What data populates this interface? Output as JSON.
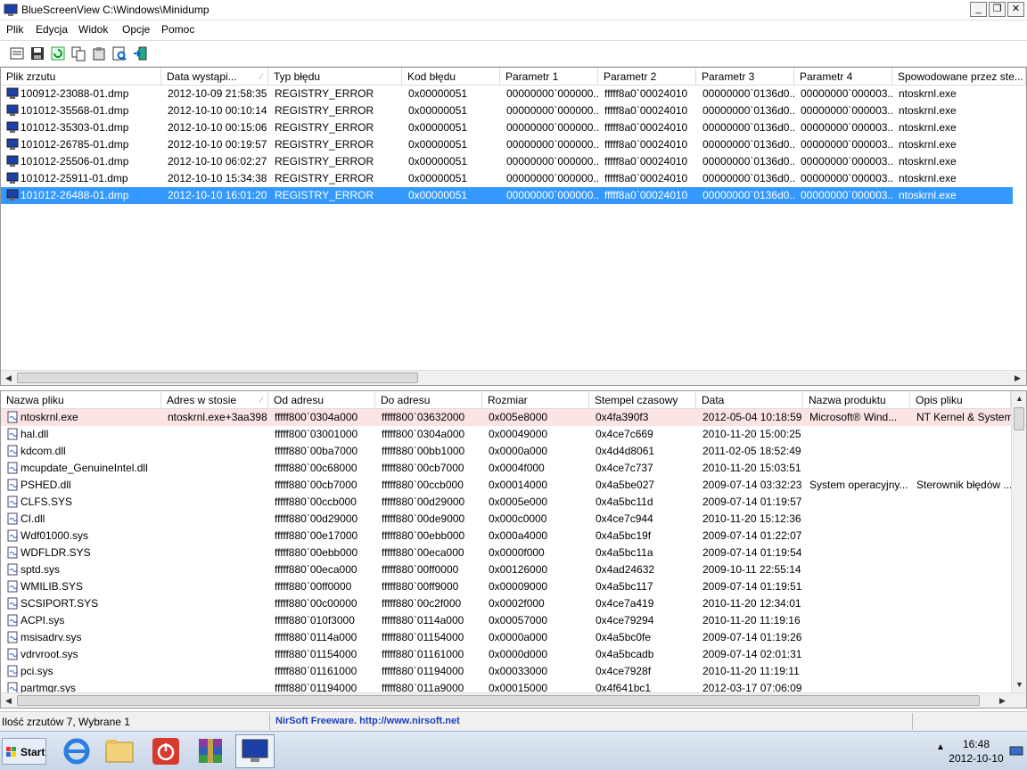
{
  "window": {
    "title": "BlueScreenView   C:\\Windows\\Minidump"
  },
  "menu": [
    "Plik",
    "Edycja",
    "Widok",
    "Opcje",
    "Pomoc"
  ],
  "toolbar": [
    "save-icon",
    "refresh-icon",
    "copy-icon",
    "properties-icon",
    "find-icon",
    "exit-icon"
  ],
  "dumps": {
    "columns": [
      "Plik zrzutu",
      "Data wystąpi...",
      "Typ błędu",
      "Kod błędu",
      "Parametr 1",
      "Parametr 2",
      "Parametr 3",
      "Parametr 4",
      "Spowodowane przez ste..."
    ],
    "sorted_column_indicator": "⁄",
    "rows": [
      [
        "100912-23088-01.dmp",
        "2012-10-09 21:58:35",
        "REGISTRY_ERROR",
        "0x00000051",
        "00000000`000000...",
        "fffff8a0`00024010",
        "00000000`0136d0...",
        "00000000`000003...",
        "ntoskrnl.exe"
      ],
      [
        "101012-35568-01.dmp",
        "2012-10-10 00:10:14",
        "REGISTRY_ERROR",
        "0x00000051",
        "00000000`000000...",
        "fffff8a0`00024010",
        "00000000`0136d0...",
        "00000000`000003...",
        "ntoskrnl.exe"
      ],
      [
        "101012-35303-01.dmp",
        "2012-10-10 00:15:06",
        "REGISTRY_ERROR",
        "0x00000051",
        "00000000`000000...",
        "fffff8a0`00024010",
        "00000000`0136d0...",
        "00000000`000003...",
        "ntoskrnl.exe"
      ],
      [
        "101012-26785-01.dmp",
        "2012-10-10 00:19:57",
        "REGISTRY_ERROR",
        "0x00000051",
        "00000000`000000...",
        "fffff8a0`00024010",
        "00000000`0136d0...",
        "00000000`000003...",
        "ntoskrnl.exe"
      ],
      [
        "101012-25506-01.dmp",
        "2012-10-10 06:02:27",
        "REGISTRY_ERROR",
        "0x00000051",
        "00000000`000000...",
        "fffff8a0`00024010",
        "00000000`0136d0...",
        "00000000`000003...",
        "ntoskrnl.exe"
      ],
      [
        "101012-25911-01.dmp",
        "2012-10-10 15:34:38",
        "REGISTRY_ERROR",
        "0x00000051",
        "00000000`000000...",
        "fffff8a0`00024010",
        "00000000`0136d0...",
        "00000000`000003...",
        "ntoskrnl.exe"
      ],
      [
        "101012-26488-01.dmp",
        "2012-10-10 16:01:20",
        "REGISTRY_ERROR",
        "0x00000051",
        "00000000`000000...",
        "fffff8a0`00024010",
        "00000000`0136d0...",
        "00000000`000003...",
        "ntoskrnl.exe"
      ]
    ],
    "selected_row": 6
  },
  "modules": {
    "columns": [
      "Nazwa pliku",
      "Adres w stosie",
      "Od adresu",
      "Do adresu",
      "Rozmiar",
      "Stempel czasowy",
      "Data",
      "Nazwa produktu",
      "Opis pliku"
    ],
    "highlighted_row": 0,
    "rows": [
      [
        "ntoskrnl.exe",
        "ntoskrnl.exe+3aa398",
        "fffff800`0304a000",
        "fffff800`03632000",
        "0x005e8000",
        "0x4fa390f3",
        "2012-05-04 10:18:59",
        "Microsoft® Wind...",
        "NT Kernel & System"
      ],
      [
        "hal.dll",
        "",
        "fffff800`03001000",
        "fffff800`0304a000",
        "0x00049000",
        "0x4ce7c669",
        "2010-11-20 15:00:25",
        "",
        ""
      ],
      [
        "kdcom.dll",
        "",
        "fffff880`00ba7000",
        "fffff880`00bb1000",
        "0x0000a000",
        "0x4d4d8061",
        "2011-02-05 18:52:49",
        "",
        ""
      ],
      [
        "mcupdate_GenuineIntel.dll",
        "",
        "fffff880`00c68000",
        "fffff880`00cb7000",
        "0x0004f000",
        "0x4ce7c737",
        "2010-11-20 15:03:51",
        "",
        ""
      ],
      [
        "PSHED.dll",
        "",
        "fffff880`00cb7000",
        "fffff880`00ccb000",
        "0x00014000",
        "0x4a5be027",
        "2009-07-14 03:32:23",
        "System operacyjny...",
        "Sterownik błędów ..."
      ],
      [
        "CLFS.SYS",
        "",
        "fffff880`00ccb000",
        "fffff880`00d29000",
        "0x0005e000",
        "0x4a5bc11d",
        "2009-07-14 01:19:57",
        "",
        ""
      ],
      [
        "CI.dll",
        "",
        "fffff880`00d29000",
        "fffff880`00de9000",
        "0x000c0000",
        "0x4ce7c944",
        "2010-11-20 15:12:36",
        "",
        ""
      ],
      [
        "Wdf01000.sys",
        "",
        "fffff880`00e17000",
        "fffff880`00ebb000",
        "0x000a4000",
        "0x4a5bc19f",
        "2009-07-14 01:22:07",
        "",
        ""
      ],
      [
        "WDFLDR.SYS",
        "",
        "fffff880`00ebb000",
        "fffff880`00eca000",
        "0x0000f000",
        "0x4a5bc11a",
        "2009-07-14 01:19:54",
        "",
        ""
      ],
      [
        "sptd.sys",
        "",
        "fffff880`00eca000",
        "fffff880`00ff0000",
        "0x00126000",
        "0x4ad24632",
        "2009-10-11 22:55:14",
        "",
        ""
      ],
      [
        "WMILIB.SYS",
        "",
        "fffff880`00ff0000",
        "fffff880`00ff9000",
        "0x00009000",
        "0x4a5bc117",
        "2009-07-14 01:19:51",
        "",
        ""
      ],
      [
        "SCSIPORT.SYS",
        "",
        "fffff880`00c00000",
        "fffff880`00c2f000",
        "0x0002f000",
        "0x4ce7a419",
        "2010-11-20 12:34:01",
        "",
        ""
      ],
      [
        "ACPI.sys",
        "",
        "fffff880`010f3000",
        "fffff880`0114a000",
        "0x00057000",
        "0x4ce79294",
        "2010-11-20 11:19:16",
        "",
        ""
      ],
      [
        "msisadrv.sys",
        "",
        "fffff880`0114a000",
        "fffff880`01154000",
        "0x0000a000",
        "0x4a5bc0fe",
        "2009-07-14 01:19:26",
        "",
        ""
      ],
      [
        "vdrvroot.sys",
        "",
        "fffff880`01154000",
        "fffff880`01161000",
        "0x0000d000",
        "0x4a5bcadb",
        "2009-07-14 02:01:31",
        "",
        ""
      ],
      [
        "pci.sys",
        "",
        "fffff880`01161000",
        "fffff880`01194000",
        "0x00033000",
        "0x4ce7928f",
        "2010-11-20 11:19:11",
        "",
        ""
      ],
      [
        "partmgr.sys",
        "",
        "fffff880`01194000",
        "fffff880`011a9000",
        "0x00015000",
        "0x4f641bc1",
        "2012-03-17 07:06:09",
        "",
        ""
      ]
    ]
  },
  "status": {
    "count_text": "Ilość zrzutów 7, Wybrane 1",
    "link_text": "NirSoft Freeware.  http://www.nirsoft.net"
  },
  "taskbar": {
    "start_label": "Start",
    "apps": [
      "internet-explorer-icon",
      "folder-icon",
      "power-icon",
      "winrar-icon",
      "bluescreenview-icon"
    ],
    "clock_time": "16:48",
    "clock_date": "2012-10-10"
  },
  "colors": {
    "selection": "#3399ff",
    "highlight_row": "#fce4e4",
    "link": "#1c3fbf"
  }
}
